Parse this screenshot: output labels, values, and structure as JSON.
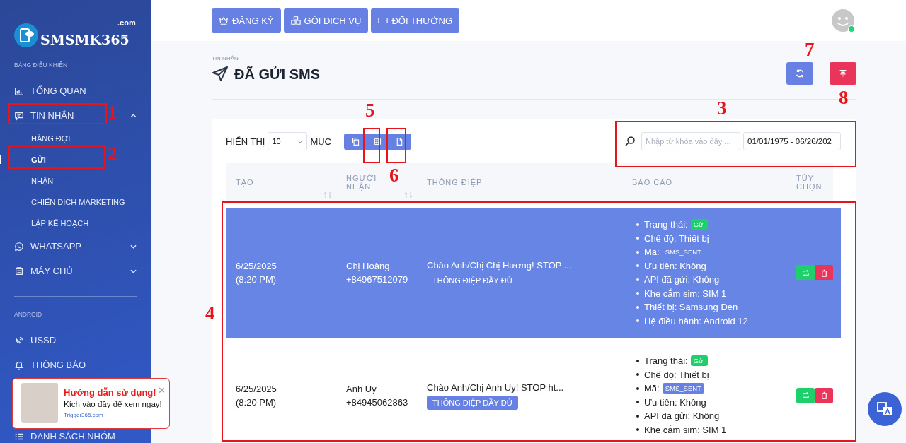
{
  "sidebar": {
    "logo": {
      "text": "SMSMK365",
      "suffix": ".com"
    },
    "sections": [
      {
        "heading": "BẢNG ĐIỀU KHIỂN",
        "items": [
          {
            "label": "TỔNG QUAN"
          },
          {
            "label": "TIN NHẮN",
            "expanded": true,
            "children": [
              {
                "label": "HÀNG ĐỢI",
                "selected": false
              },
              {
                "label": "GỬI",
                "selected": true
              },
              {
                "label": "NHẬN",
                "selected": false
              },
              {
                "label": "CHIẾN DỊCH MARKETING",
                "selected": false
              },
              {
                "label": "LẬP KẾ HOẠCH",
                "selected": false
              }
            ]
          },
          {
            "label": "WHATSAPP",
            "expanded": false
          },
          {
            "label": "MÁY CHỦ",
            "expanded": false
          }
        ]
      },
      {
        "heading": "ANDROID",
        "items": [
          {
            "label": "USSD"
          },
          {
            "label": "THÔNG BÁO"
          }
        ]
      },
      {
        "items": [
          {
            "label": "DANH SÁCH NHÓM"
          }
        ]
      }
    ]
  },
  "topbar": {
    "buttons": [
      {
        "label": "ĐĂNG KÝ"
      },
      {
        "label": "GÓI DỊCH VỤ"
      },
      {
        "label": "ĐỔI THƯỞNG"
      }
    ],
    "user": {
      "online": true
    }
  },
  "page": {
    "breadcrumb": "TIN NHẮN",
    "title": "ĐÃ GỬI SMS",
    "actions": [
      {
        "kind": "refresh"
      },
      {
        "kind": "clear"
      }
    ]
  },
  "table": {
    "show_label": "HIỂN THỊ",
    "page_size": "10",
    "entries_label": "MỤC",
    "tools": [
      {
        "kind": "copy"
      },
      {
        "kind": "grid"
      },
      {
        "kind": "file"
      }
    ],
    "search": {
      "placeholder": "Nhập từ khóa vào đây ..."
    },
    "date_range": "01/01/1975 - 06/26/202",
    "columns": [
      {
        "label": "TẠO",
        "sortable": true
      },
      {
        "label": "NGƯỜI NHẬN",
        "sortable": true
      },
      {
        "label": "THÔNG ĐIỆP",
        "sortable": false
      },
      {
        "label": "BÁO CÁO",
        "sortable": false
      },
      {
        "label": "TÙY CHỌN",
        "sortable": false
      }
    ],
    "rows": [
      {
        "selected": true,
        "date": "6/25/2025",
        "time": "(8:20 PM)",
        "name": "Chị Hoàng",
        "phone": "+84967512079",
        "message": "Chào Anh/Chị Chị Hương! STOP ...",
        "full_button": "THÔNG ĐIỆP ĐẦY ĐỦ",
        "report": [
          {
            "label": "Trạng thái:",
            "badge": "Gửi",
            "kind": "status"
          },
          {
            "label": "Chế độ: Thiết bị"
          },
          {
            "label": "Mã:",
            "badge": "SMS_SENT",
            "kind": "code"
          },
          {
            "label": "Ưu tiên: Không"
          },
          {
            "label": "API đã gửi: Không"
          },
          {
            "label": "Khe cắm sim: SIM 1"
          },
          {
            "label": "Thiết bị: Samsung Đen"
          },
          {
            "label": "Hệ điều hành: Android 12"
          }
        ]
      },
      {
        "selected": false,
        "date": "6/25/2025",
        "time": "(8:20 PM)",
        "name": "Anh Uy",
        "phone": "+84945062863",
        "message": "Chào Anh/Chị Anh Uy! STOP ht...",
        "full_button": "THÔNG ĐIỆP ĐẦY ĐỦ",
        "report": [
          {
            "label": "Trạng thái:",
            "badge": "Gửi",
            "kind": "status"
          },
          {
            "label": "Chế độ: Thiết bị"
          },
          {
            "label": "Mã:",
            "badge": "SMS_SENT",
            "kind": "code"
          },
          {
            "label": "Ưu tiên: Không"
          },
          {
            "label": "API đã gửi: Không"
          },
          {
            "label": "Khe cắm sim: SIM 1"
          }
        ]
      }
    ]
  },
  "popup": {
    "title": "Hướng dẫn sử dụng!",
    "subtitle": "Kích vào đây để xem ngay!",
    "link": "Trigger365.com",
    "close": "✕"
  },
  "annotations": [
    {
      "label": "1",
      "boxed": true
    },
    {
      "label": "2",
      "boxed": true
    },
    {
      "label": "3",
      "boxed": true
    },
    {
      "label": "4",
      "boxed": true
    },
    {
      "label": "5",
      "boxed": true
    },
    {
      "label": "6",
      "boxed": true
    },
    {
      "label": "7",
      "boxed": false
    },
    {
      "label": "8",
      "boxed": false
    }
  ]
}
